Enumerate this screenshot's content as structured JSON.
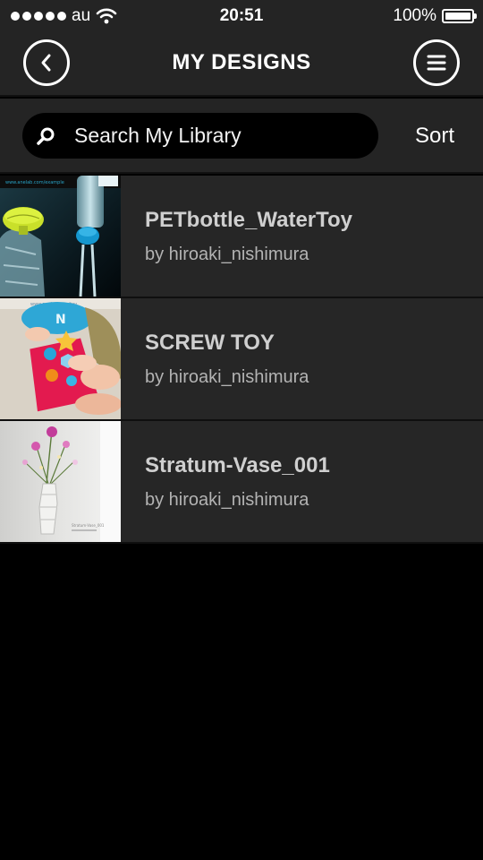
{
  "status_bar": {
    "carrier": "au",
    "time": "20:51",
    "battery_percent": "100%"
  },
  "header": {
    "title": "MY DESIGNS",
    "back_icon": "chevron-left-icon",
    "menu_icon": "hamburger-menu-icon"
  },
  "search": {
    "placeholder": "Search My Library",
    "sort_label": "Sort"
  },
  "designs": [
    {
      "title": "PETbottle_WaterToy",
      "author": "by hiroaki_nishimura"
    },
    {
      "title": "SCREW TOY",
      "author": "by hiroaki_nishimura"
    },
    {
      "title": "Stratum-Vase_001",
      "author": "by hiroaki_nishimura"
    }
  ],
  "colors": {
    "bar_background": "#242424",
    "list_background": "#262626",
    "page_background": "#000000"
  }
}
